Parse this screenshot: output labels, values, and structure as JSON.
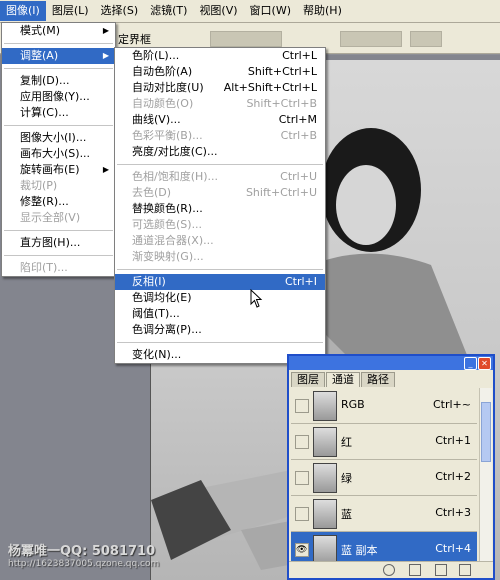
{
  "menubar": {
    "items": [
      {
        "label": "图像(I)",
        "active": true
      },
      {
        "label": "图层(L)"
      },
      {
        "label": "选择(S)"
      },
      {
        "label": "滤镜(T)"
      },
      {
        "label": "视图(V)"
      },
      {
        "label": "窗口(W)"
      },
      {
        "label": "帮助(H)"
      }
    ]
  },
  "options_bar": {
    "label": "定界框"
  },
  "image_menu": {
    "items": [
      {
        "label": "模式(M)",
        "submenu": true
      },
      {
        "sep": true
      },
      {
        "label": "调整(A)",
        "submenu": true,
        "highlight": true
      },
      {
        "sep": true
      },
      {
        "label": "复制(D)..."
      },
      {
        "label": "应用图像(Y)..."
      },
      {
        "label": "计算(C)..."
      },
      {
        "sep": true
      },
      {
        "label": "图像大小(I)..."
      },
      {
        "label": "画布大小(S)..."
      },
      {
        "label": "旋转画布(E)",
        "submenu": true
      },
      {
        "label": "裁切(P)",
        "disabled": true
      },
      {
        "label": "修整(R)..."
      },
      {
        "label": "显示全部(V)",
        "disabled": true
      },
      {
        "sep": true
      },
      {
        "label": "直方图(H)..."
      },
      {
        "sep": true
      },
      {
        "label": "陷印(T)...",
        "disabled": true
      }
    ]
  },
  "adjust_menu": {
    "items": [
      {
        "label": "色阶(L)...",
        "shortcut": "Ctrl+L"
      },
      {
        "label": "自动色阶(A)",
        "shortcut": "Shift+Ctrl+L"
      },
      {
        "label": "自动对比度(U)",
        "shortcut": "Alt+Shift+Ctrl+L"
      },
      {
        "label": "自动颜色(O)",
        "shortcut": "Shift+Ctrl+B",
        "disabled": true
      },
      {
        "label": "曲线(V)...",
        "shortcut": "Ctrl+M"
      },
      {
        "label": "色彩平衡(B)...",
        "shortcut": "Ctrl+B",
        "disabled": true
      },
      {
        "label": "亮度/对比度(C)..."
      },
      {
        "sep": true
      },
      {
        "label": "色相/饱和度(H)...",
        "shortcut": "Ctrl+U",
        "disabled": true
      },
      {
        "label": "去色(D)",
        "shortcut": "Shift+Ctrl+U",
        "disabled": true
      },
      {
        "label": "替换颜色(R)..."
      },
      {
        "label": "可选颜色(S)...",
        "disabled": true
      },
      {
        "label": "通道混合器(X)...",
        "disabled": true
      },
      {
        "label": "渐变映射(G)...",
        "disabled": true
      },
      {
        "sep": true
      },
      {
        "label": "反相(I)",
        "shortcut": "Ctrl+I",
        "highlight": true
      },
      {
        "label": "色调均化(E)"
      },
      {
        "label": "阈值(T)..."
      },
      {
        "label": "色调分离(P)..."
      },
      {
        "sep": true
      },
      {
        "label": "变化(N)..."
      }
    ]
  },
  "channels_panel": {
    "tabs": [
      "图层",
      "通道",
      "路径"
    ],
    "active_tab": 1,
    "rows": [
      {
        "name": "RGB",
        "shortcut": "Ctrl+~"
      },
      {
        "name": "红",
        "shortcut": "Ctrl+1"
      },
      {
        "name": "绿",
        "shortcut": "Ctrl+2"
      },
      {
        "name": "蓝",
        "shortcut": "Ctrl+3"
      },
      {
        "name": "蓝 副本",
        "shortcut": "Ctrl+4",
        "selected": true,
        "visible": true
      }
    ]
  },
  "watermark": {
    "line1": "杨冪唯一QQ: 5081710",
    "line2": "http://1623837005.qzone.qq.com"
  },
  "colors": {
    "highlight": "#316ac5",
    "menu_bg": "#ffffff",
    "chrome": "#ece9d8"
  }
}
